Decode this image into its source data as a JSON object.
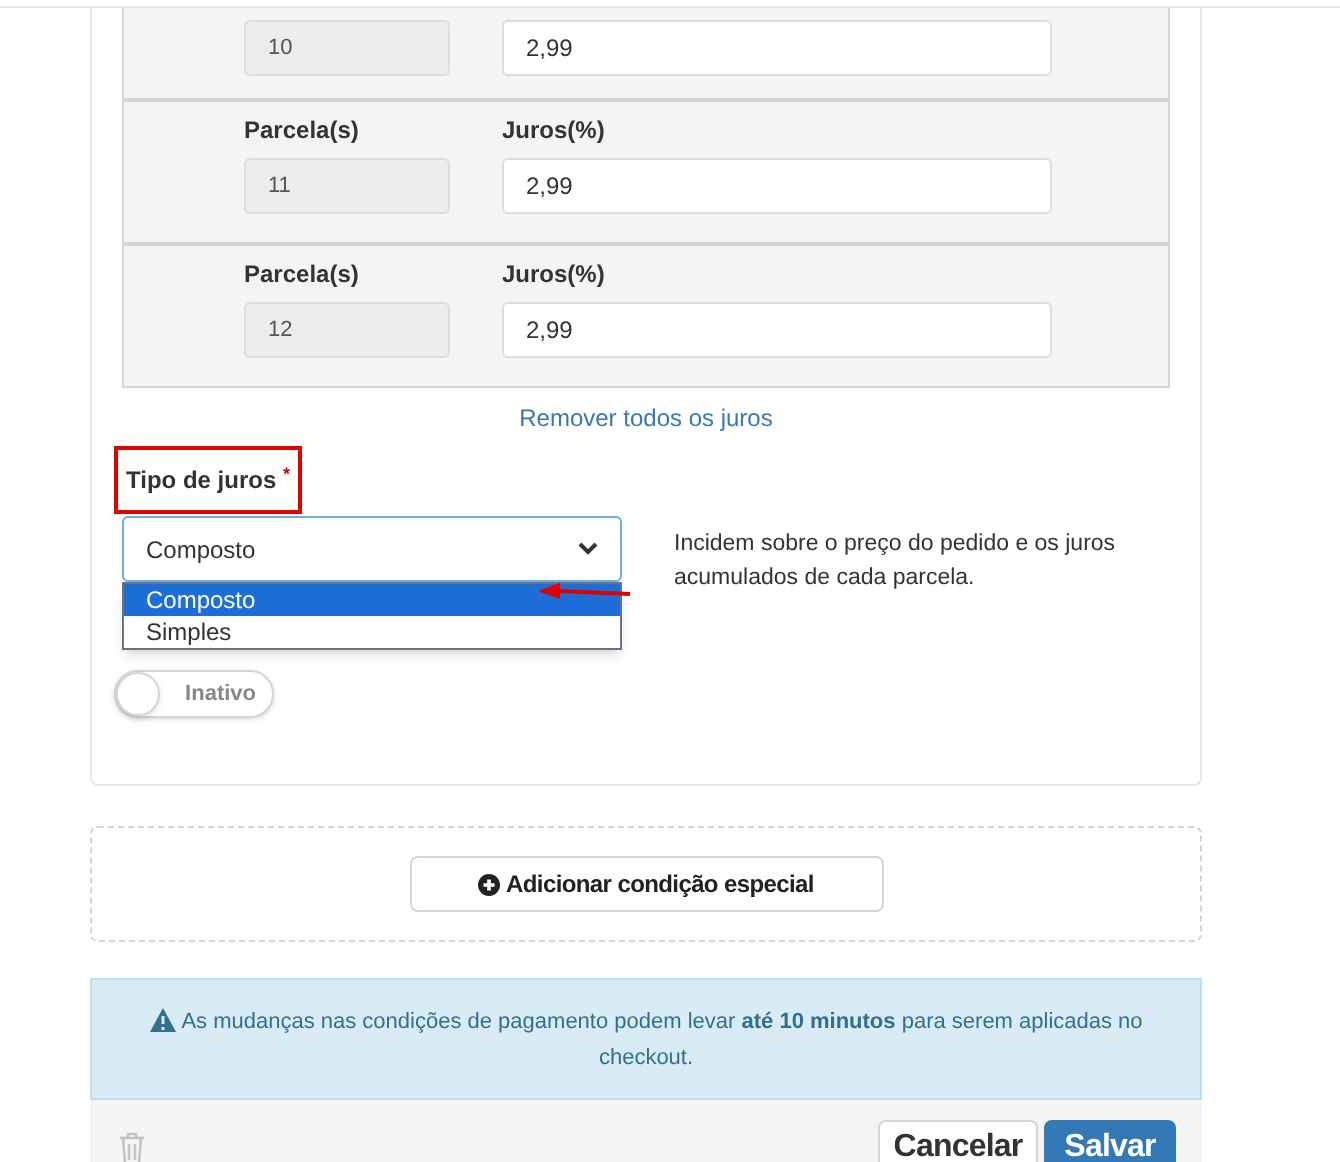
{
  "installments": [
    {
      "parcel": "10",
      "interest": "2,99"
    },
    {
      "parcel_label": "Parcela(s)",
      "interest_label": "Juros(%)",
      "parcel": "11",
      "interest": "2,99"
    },
    {
      "parcel_label": "Parcela(s)",
      "interest_label": "Juros(%)",
      "parcel": "12",
      "interest": "2,99"
    }
  ],
  "remove_link": "Remover todos os juros",
  "interest_type": {
    "label": "Tipo de juros",
    "required_mark": "*",
    "value": "Composto",
    "expanded": true,
    "options": [
      {
        "label": "Composto",
        "selected": true
      },
      {
        "label": "Simples",
        "selected": false
      }
    ],
    "description": "Incidem sobre o preço do pedido e os juros acumulados de cada parcela."
  },
  "status_toggle": {
    "on": false,
    "label": "Inativo"
  },
  "add_button": "Adicionar condição especial",
  "alert": "As mudanças nas condições de pagamento podem levar **até 10 minutos** para serem aplicadas no checkout.",
  "buttons": {
    "cancel": "Cancelar",
    "save": "Salvar"
  }
}
